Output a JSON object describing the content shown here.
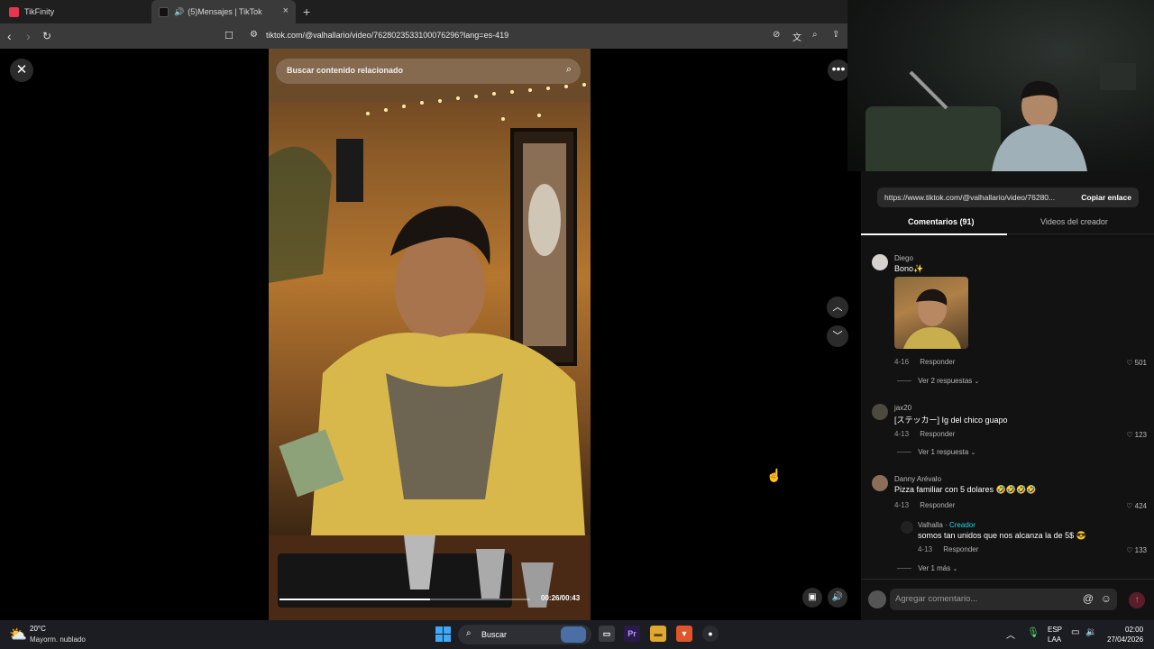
{
  "browser": {
    "tabs": [
      {
        "label": "TikFinity",
        "favicon_color": "#e8344e"
      },
      {
        "label": "(5)Mensajes | TikTok",
        "favicon_color": "#111111",
        "audio": "speaker-icon"
      }
    ],
    "new_tab": "+",
    "close_tab": "×",
    "url": "tiktok.com/@valhallario/video/7628023533100076296?lang=es-419"
  },
  "video": {
    "search_placeholder": "Buscar contenido relacionado",
    "time": "00:26/00:43",
    "progress": 0.6
  },
  "panel": {
    "share_url": "https://www.tiktok.com/@valhallario/video/76280...",
    "copy_button": "Copiar enlace",
    "tabs": {
      "comments": "Comentarios (91)",
      "creator_videos": "Videos del creador"
    },
    "comments": [
      {
        "user": "Diego",
        "text": "Bono✨",
        "date": "4-16",
        "reply": "Responder",
        "likes": "501",
        "more": "Ver 2 respuestas"
      },
      {
        "user": "jax20",
        "text": "[ステッカー] Ig del chico guapo",
        "date": "4-13",
        "reply": "Responder",
        "likes": "123",
        "more": "Ver 1 respuesta"
      },
      {
        "user": "Danny Arévalo",
        "text": "Pizza familiar con 5 dolares 🤣🤣🤣🤣",
        "date": "4-13",
        "reply": "Responder",
        "likes": "424"
      }
    ],
    "creator_reply": {
      "user": "Valhalla",
      "badge": "Creador",
      "text": "somos tan unidos que nos alcanza la de 5$ 😎",
      "date": "4-13",
      "reply": "Responder",
      "likes": "133",
      "more": "Ver 1 más"
    },
    "comment_placeholder": "Agregar comentario..."
  },
  "taskbar": {
    "weather_temp": "20°C",
    "weather_desc": "Mayorm. nublado",
    "search": "Buscar",
    "lang1": "ESP",
    "lang2": "LAA",
    "time": "02:00",
    "date": "27/04/2026"
  }
}
